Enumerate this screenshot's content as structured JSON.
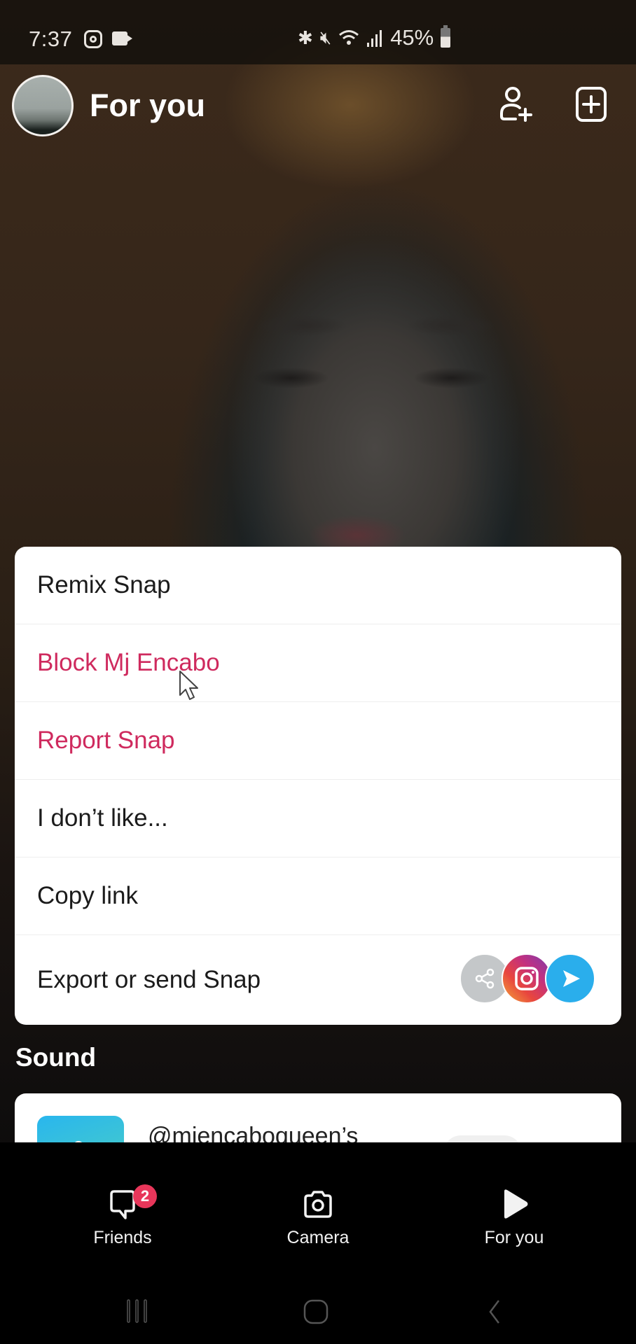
{
  "status_bar": {
    "time": "7:37",
    "notification_icons": [
      "instagram-icon",
      "video-camera-icon"
    ],
    "system_icons": [
      "bluetooth-icon",
      "vibrate-mute-icon",
      "wifi-icon",
      "signal-icon"
    ],
    "battery_percent": "45%"
  },
  "header": {
    "title": "For you",
    "actions": [
      {
        "name": "add-friend",
        "icon": "add-friend-icon"
      },
      {
        "name": "add-story",
        "icon": "plus-square-icon"
      }
    ]
  },
  "menu": {
    "items": [
      {
        "label": "Remix Snap",
        "style": "normal"
      },
      {
        "label": "Block Mj Encabo",
        "style": "danger"
      },
      {
        "label": "Report Snap",
        "style": "danger"
      },
      {
        "label": "I don’t like...",
        "style": "normal"
      },
      {
        "label": "Copy link",
        "style": "normal"
      },
      {
        "label": "Export or send Snap",
        "style": "normal"
      }
    ],
    "share_targets": [
      "share-icon",
      "instagram-icon",
      "send-icon"
    ]
  },
  "sound": {
    "section_title": "Sound",
    "name": "@mjencaboqueen’s"
  },
  "bottom_nav": {
    "items": [
      {
        "label": "Friends",
        "icon": "chat-icon",
        "badge": "2"
      },
      {
        "label": "Camera",
        "icon": "camera-icon"
      },
      {
        "label": "For you",
        "icon": "play-icon"
      }
    ]
  },
  "colors": {
    "danger": "#cf2a5e",
    "badge": "#e8365a",
    "send_blue": "#2aaeec"
  }
}
